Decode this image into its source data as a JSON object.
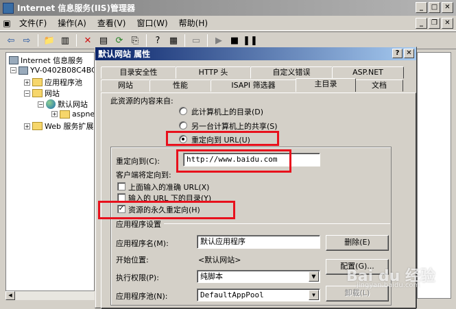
{
  "window": {
    "title": "Internet 信息服务(IIS)管理器"
  },
  "menu": [
    "文件(F)",
    "操作(A)",
    "查看(V)",
    "窗口(W)",
    "帮助(H)"
  ],
  "tree": {
    "root": "Internet 信息服务",
    "server": "YV-0402B08C4BC",
    "app_pools": "应用程序池",
    "websites": "网站",
    "default_site": "默认网站",
    "aspnet": "aspne",
    "web_ext": "Web 服务扩展"
  },
  "dialog": {
    "title": "默认网站 属性",
    "tabs_row1": [
      "目录安全性",
      "HTTP 头",
      "自定义错误",
      "ASP.NET"
    ],
    "tabs_row2": [
      "网站",
      "性能",
      "ISAPI 筛选器",
      "主目录",
      "文档"
    ],
    "active_tab": "主目录",
    "source_label": "此资源的内容来自:",
    "radio_local": "此计算机上的目录(D)",
    "radio_share": "另一台计算机上的共享(S)",
    "radio_redirect": "重定向到 URL(U)",
    "redirect_label": "重定向到(C):",
    "redirect_url": "http://www.baidu.com",
    "client_label": "客户端将定向到:",
    "check_exact": "上面输入的准确 URL(X)",
    "check_below": "输入的 URL 下的目录(Y)",
    "check_permanent": "资源的永久重定向(H)",
    "app_settings": "应用程序设置",
    "app_name_label": "应用程序名(M):",
    "app_name": "默认应用程序",
    "start_label": "开始位置:",
    "start_value": "<默认网站>",
    "exec_label": "执行权限(P):",
    "exec_value": "纯脚本",
    "pool_label": "应用程序池(N):",
    "pool_value": "DefaultAppPool",
    "btn_delete": "删除(E)",
    "btn_config": "配置(G)...",
    "btn_unload": "卸载(L)"
  },
  "watermark": {
    "logo": "Bai du 经验",
    "url": "jingyan.baidu.com"
  }
}
